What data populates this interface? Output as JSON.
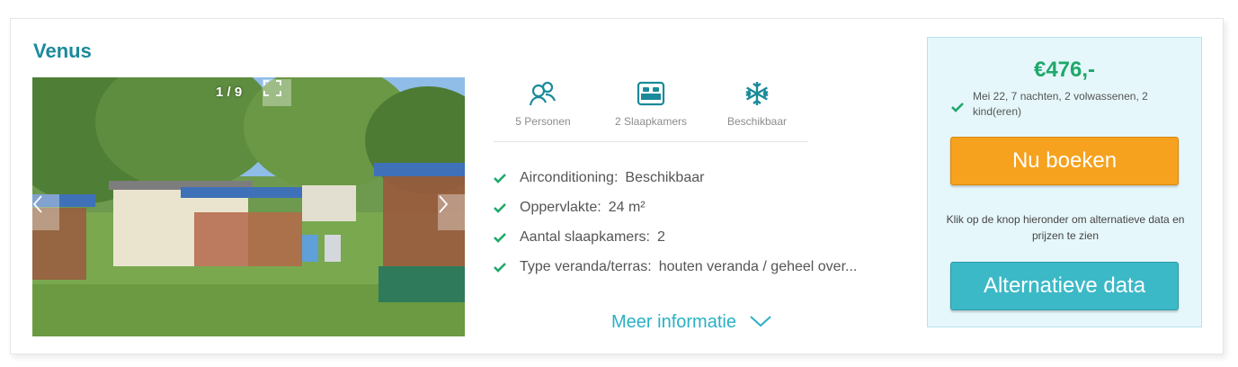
{
  "title": "Venus",
  "gallery": {
    "counter": "1 / 9"
  },
  "features": [
    {
      "icon": "persons-icon",
      "label": "5 Personen"
    },
    {
      "icon": "bed-icon",
      "label": "2 Slaapkamers"
    },
    {
      "icon": "snowflake-icon",
      "label": "Beschikbaar"
    }
  ],
  "properties": [
    {
      "key": "Airconditioning:",
      "value": "Beschikbaar"
    },
    {
      "key": "Oppervlakte:",
      "value": "24 m²"
    },
    {
      "key": "Aantal slaapkamers:",
      "value": "2"
    },
    {
      "key": "Type veranda/terras:",
      "value": "houten veranda / geheel over..."
    }
  ],
  "more_info": "Meer informatie",
  "pricebox": {
    "price": "€476,-",
    "details": "Mei 22, 7 nachten, 2 volwassenen, 2 kind(eren)",
    "book_label": "Nu boeken",
    "alt_text": "Klik op de knop hieronder om alternatieve data en prijzen te zien",
    "alt_label": "Alternatieve data"
  },
  "colors": {
    "accent": "#2bb0c5",
    "title": "#1a8a9a",
    "price": "#1fa86a",
    "book": "#f6a21e",
    "alt": "#3cb9c7",
    "check": "#1fa86a"
  }
}
